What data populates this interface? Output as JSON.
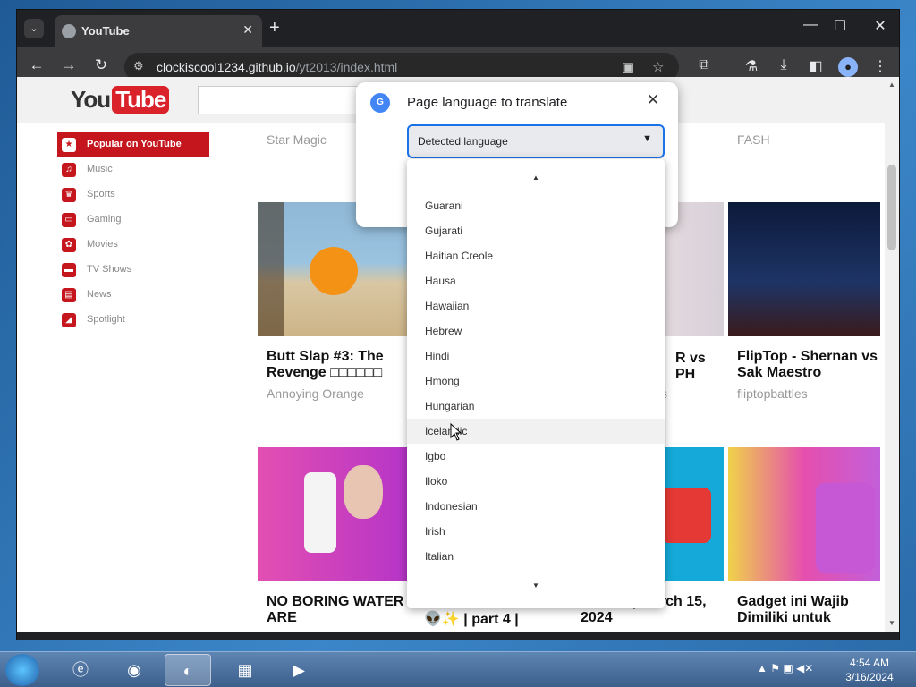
{
  "browser": {
    "tab_title": "YouTube",
    "tab_close": "✕",
    "new_tab": "+",
    "url_host": "clockiscool1234.github.io",
    "url_path": "/yt2013/index.html"
  },
  "youtube": {
    "logo_you": "You",
    "logo_tube": "Tube",
    "sidebar": [
      {
        "label": "Popular on YouTube",
        "icon": "star-icon",
        "active": true
      },
      {
        "label": "Music",
        "icon": "headphones-icon"
      },
      {
        "label": "Sports",
        "icon": "trophy-icon"
      },
      {
        "label": "Gaming",
        "icon": "gamepad-icon"
      },
      {
        "label": "Movies",
        "icon": "film-reel-icon"
      },
      {
        "label": "TV Shows",
        "icon": "tv-icon"
      },
      {
        "label": "News",
        "icon": "newspaper-icon"
      },
      {
        "label": "Spotlight",
        "icon": "spotlight-icon"
      }
    ],
    "top_row_channels": [
      "Star Magic",
      "FASH"
    ],
    "videos": [
      {
        "title": "Butt Slap #3: The Revenge □□□□□□",
        "channel": "Annoying Orange"
      },
      {
        "title": "R vs PH",
        "channel": "s"
      },
      {
        "title": "FlipTop - Shernan vs Sak Maestro",
        "channel": "fliptopbattles"
      },
      {
        "title": "NO BORING WATER ARE",
        "channel": ""
      },
      {
        "title": "👽✨ | part 4 |",
        "channel": ""
      },
      {
        "title": "nline U | March 15, 2024",
        "channel": ""
      },
      {
        "title": "Gadget ini Wajib Dimiliki untuk",
        "channel": ""
      }
    ]
  },
  "translate_popup": {
    "title": "Page language to translate",
    "select_value": "Detected language",
    "options": [
      "Guarani",
      "Gujarati",
      "Haitian Creole",
      "Hausa",
      "Hawaiian",
      "Hebrew",
      "Hindi",
      "Hmong",
      "Hungarian",
      "Icelandic",
      "Igbo",
      "Iloko",
      "Indonesian",
      "Irish",
      "Italian"
    ],
    "hovered": "Icelandic"
  },
  "taskbar": {
    "time": "4:54 AM",
    "date": "3/16/2024"
  }
}
